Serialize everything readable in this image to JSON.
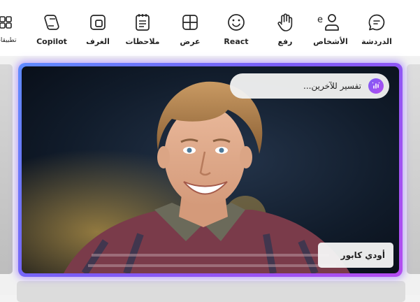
{
  "toolbar": {
    "items": [
      {
        "id": "chat",
        "label": "الدردشة",
        "icon": "chat-icon"
      },
      {
        "id": "people",
        "label": "الأشخاص",
        "icon": "people-icon",
        "badge": "e"
      },
      {
        "id": "raise",
        "label": "رفع",
        "icon": "raise-hand-icon"
      },
      {
        "id": "react",
        "label": "React",
        "icon": "react-emoji-icon"
      },
      {
        "id": "view",
        "label": "عرض",
        "icon": "view-grid-icon"
      },
      {
        "id": "notes",
        "label": "ملاحظات",
        "icon": "notes-icon"
      },
      {
        "id": "rooms",
        "label": "الغرف",
        "icon": "rooms-icon"
      },
      {
        "id": "copilot",
        "label": "Copilot",
        "icon": "copilot-icon"
      },
      {
        "id": "apps",
        "label": "تطبيقات",
        "icon": "apps-icon"
      }
    ]
  },
  "video": {
    "caption_label": "تفسير للآخرين...",
    "caption_icon": "interpret-icon",
    "participant_name": "أودي كابور"
  },
  "colors": {
    "frame_gradient": [
      "#5f8bff",
      "#7b5cf6",
      "#b44cf0"
    ],
    "toolbar_bg": "#ffffff"
  }
}
